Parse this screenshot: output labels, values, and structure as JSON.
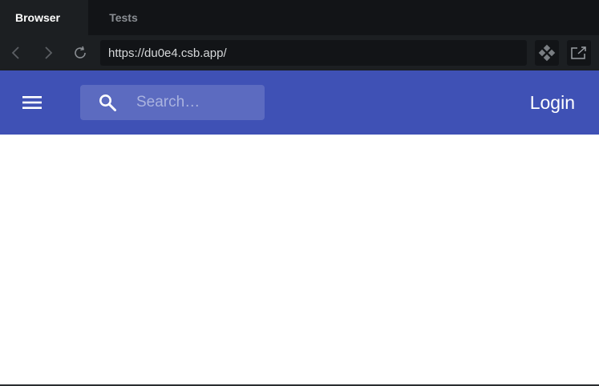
{
  "tabs": [
    {
      "label": "Browser",
      "active": true
    },
    {
      "label": "Tests",
      "active": false
    }
  ],
  "address": {
    "url": "https://du0e4.csb.app/"
  },
  "icons": {
    "back": "chevron-left-icon",
    "forward": "chevron-right-icon",
    "reload": "reload-icon",
    "devtools": "codesandbox-icon",
    "open_external": "open-external-icon",
    "menu": "hamburger-menu-icon",
    "search": "search-icon"
  },
  "appbar": {
    "search_placeholder": "Search…",
    "login_label": "Login"
  },
  "colors": {
    "tabbar_bg": "#121417",
    "toolbar_bg": "#1c1f22",
    "appbar_bg": "#3f51b5",
    "search_bg": "#5c6bc0",
    "content_bg": "#ffffff"
  }
}
